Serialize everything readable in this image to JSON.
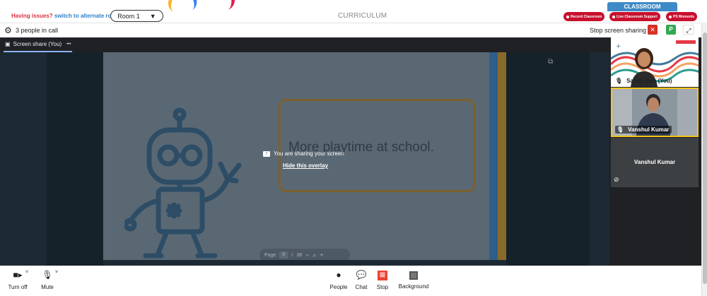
{
  "portal": {
    "issue_question": "Having issues?",
    "issue_link": "switch to alternate room",
    "room_label": "Room 1",
    "room_caret": "▼",
    "curriculum_label": "CURRICULUM",
    "classroom_tab": "CLASSROOM",
    "pills": [
      "Record Classroom",
      "Live Classroom Support",
      "PS Moments"
    ]
  },
  "meet": {
    "people_count": "3 people in call",
    "stop_share_label": "Stop screen sharing",
    "close_glyph": "✕",
    "participant_initial": "P",
    "expand_glyph": "⤢",
    "share_tab_label": "Screen share (You)",
    "share_tab_more": "•••"
  },
  "slide": {
    "headline": "More playtime at school.",
    "page_label": "Page",
    "page_current": "6",
    "page_sep": "/",
    "page_total": "38",
    "zoom_out": "−",
    "zoom_in": "+"
  },
  "overlay": {
    "message": "You are sharing your screen",
    "hide_link": "Hide this overlay"
  },
  "participants": [
    {
      "name": "Samta Jain (You)"
    },
    {
      "name": "Vanshul Kumar"
    },
    {
      "name": "Vanshul Kumar"
    }
  ],
  "controls": {
    "camera": "Turn off",
    "mic": "Mute",
    "people": "People",
    "chat": "Chat",
    "stop": "Stop",
    "background": "Background"
  },
  "colors": {
    "stage_bg": "#202124",
    "accent_red": "#c8102e",
    "classroom_blue": "#3e8ac7",
    "active_speaker_border": "#f5c518",
    "tab_underline": "#8ab4f8"
  },
  "icons": {
    "settings": "gear-icon",
    "camera": "video-camera-icon",
    "mic": "microphone-icon",
    "people": "person-icon",
    "chat": "chat-bubble-icon",
    "stop": "stop-present-icon",
    "background": "background-icon",
    "popout": "open-in-new-icon",
    "muted": "mic-off-icon"
  }
}
